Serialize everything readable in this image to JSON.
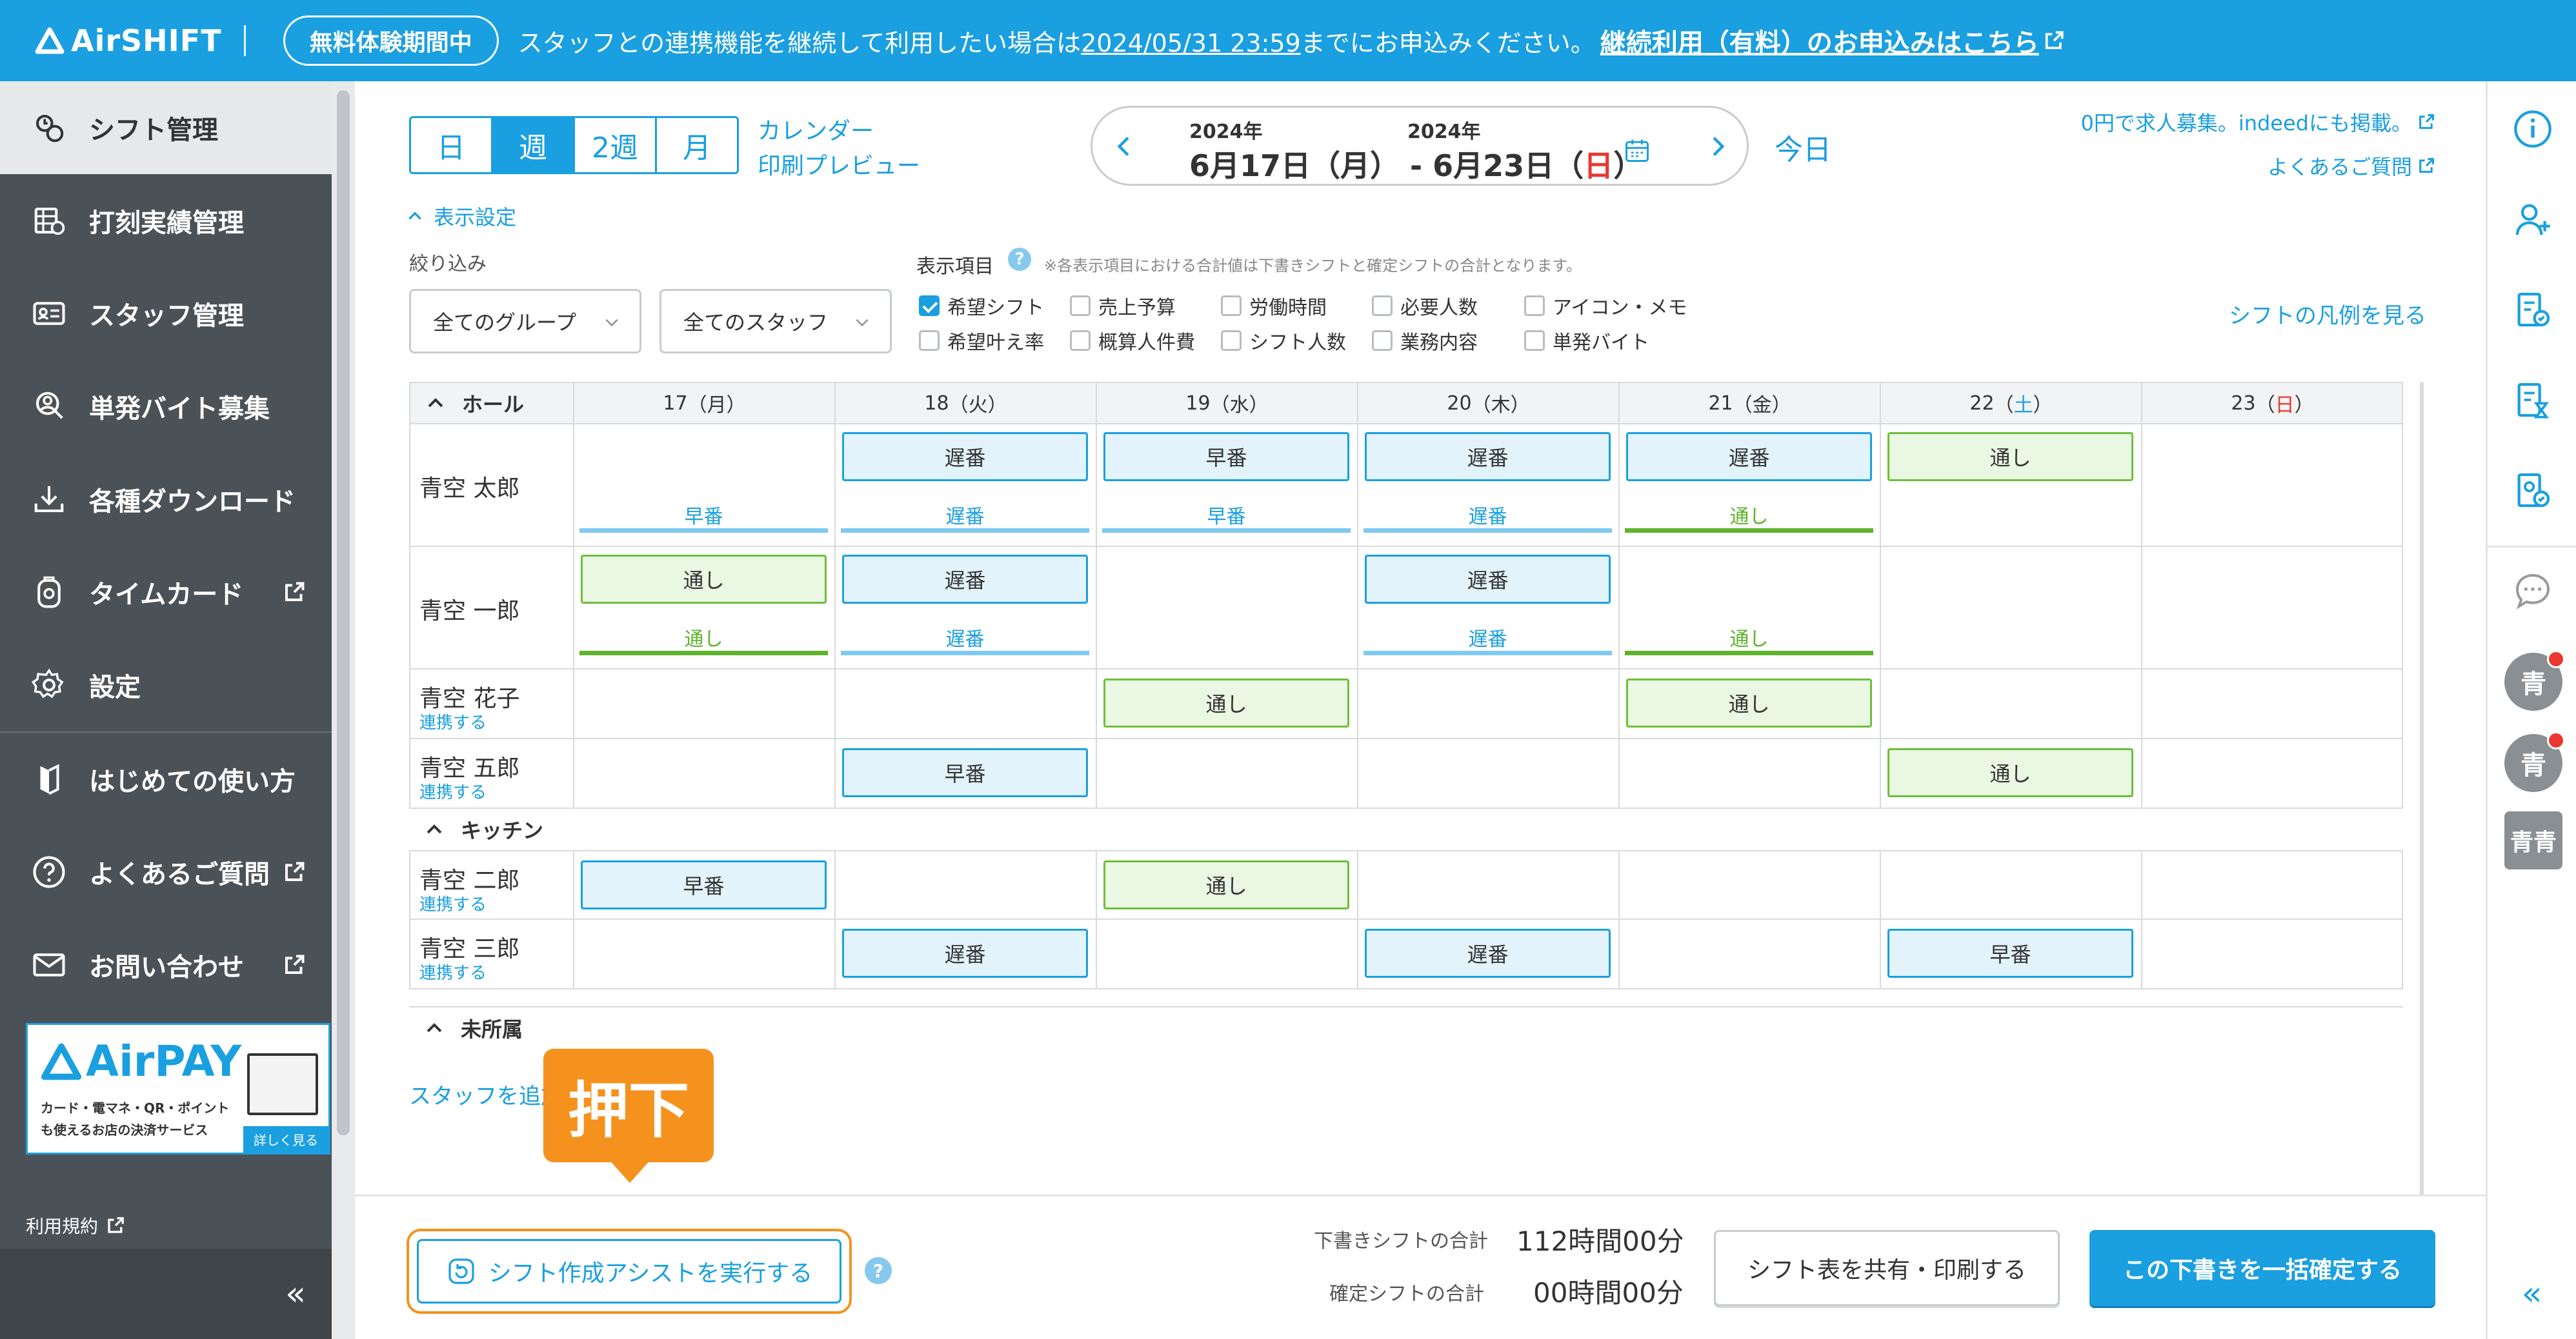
{
  "banner": {
    "logo": "AirSHIFT",
    "trial_badge": "無料体験期間中",
    "message_pre": "スタッフとの連携機能を継続して利用したい場合は",
    "message_date": "2024/05/31 23:59",
    "message_post": "までにお申込みください。",
    "cta": "継続利用（有料）のお申込みはこちら"
  },
  "sidebar": {
    "items": [
      {
        "label": "シフト管理",
        "icon": "shift-icon"
      },
      {
        "label": "打刻実績管理",
        "icon": "clock-record-icon"
      },
      {
        "label": "スタッフ管理",
        "icon": "staff-card-icon"
      },
      {
        "label": "単発バイト募集",
        "icon": "recruit-icon"
      },
      {
        "label": "各種ダウンロード",
        "icon": "download-icon"
      },
      {
        "label": "タイムカード",
        "icon": "timecard-icon"
      },
      {
        "label": "設定",
        "icon": "gear-icon"
      },
      {
        "label": "はじめての使い方",
        "icon": "guide-icon"
      },
      {
        "label": "よくあるご質問",
        "icon": "question-icon"
      },
      {
        "label": "お問い合わせ",
        "icon": "mail-icon"
      }
    ],
    "ad": {
      "logo": "AirPAY",
      "desc": "カード・電マネ・QR・ポイントも使えるお店の決済サービス",
      "more": "詳しく見る"
    },
    "terms": "利用規約",
    "collapse": "«"
  },
  "toolbar": {
    "views": [
      "日",
      "週",
      "2週",
      "月"
    ],
    "calendar_preview": "カレンダー",
    "print_preview": "印刷プレビュー",
    "year_start": "2024年",
    "year_end": "2024年",
    "range_start": "6月17日（月）",
    "range_sep": " - ",
    "range_end_pre": "6月23日（",
    "range_end_day": "日",
    "range_end_post": "）",
    "today": "今日",
    "indeed_link": "0円で求人募集。indeedにも掲載。",
    "faq_link": "よくあるご質問"
  },
  "settings": {
    "toggle": "表示設定",
    "filter_label": "絞り込み",
    "group_select": "全てのグループ",
    "staff_select": "全てのスタッフ",
    "items_label": "表示項目",
    "items_note": "※各表示項目における合計値は下書きシフトと確定シフトの合計となります。",
    "checkboxes": [
      {
        "label": "希望シフト",
        "checked": true
      },
      {
        "label": "売上予算",
        "checked": false
      },
      {
        "label": "労働時間",
        "checked": false
      },
      {
        "label": "必要人数",
        "checked": false
      },
      {
        "label": "アイコン・メモ",
        "checked": false
      },
      {
        "label": "希望叶え率",
        "checked": false
      },
      {
        "label": "概算人件費",
        "checked": false
      },
      {
        "label": "シフト人数",
        "checked": false
      },
      {
        "label": "業務内容",
        "checked": false
      },
      {
        "label": "単発バイト",
        "checked": false
      }
    ],
    "legend_link": "シフトの凡例を見る"
  },
  "grid": {
    "days": [
      {
        "num": "17",
        "wd": "月",
        "color": "#333333"
      },
      {
        "num": "18",
        "wd": "火",
        "color": "#333333"
      },
      {
        "num": "19",
        "wd": "水",
        "color": "#333333"
      },
      {
        "num": "20",
        "wd": "木",
        "color": "#333333"
      },
      {
        "num": "21",
        "wd": "金",
        "color": "#333333"
      },
      {
        "num": "22",
        "wd": "土",
        "color": "#1a9fe0"
      },
      {
        "num": "23",
        "wd": "日",
        "color": "#e8382f"
      }
    ],
    "groups": [
      "ホール",
      "キッチン",
      "未所属"
    ],
    "link_label": "連携する",
    "add_staff": "スタッフを追加",
    "staff": [
      {
        "name": "青空 太郎",
        "group": 0,
        "linked": true,
        "shifts": [
          null,
          [
            "遅番",
            "b"
          ],
          [
            "早番",
            "b"
          ],
          [
            "遅番",
            "b"
          ],
          [
            "遅番",
            "b"
          ],
          [
            "通し",
            "g"
          ],
          null
        ],
        "hopes": [
          [
            "早番",
            "b"
          ],
          [
            "遅番",
            "b"
          ],
          [
            "早番",
            "b"
          ],
          [
            "遅番",
            "b"
          ],
          [
            "通し",
            "g"
          ],
          null,
          null
        ]
      },
      {
        "name": "青空 一郎",
        "group": 0,
        "linked": true,
        "shifts": [
          [
            "通し",
            "g"
          ],
          [
            "遅番",
            "b"
          ],
          null,
          [
            "遅番",
            "b"
          ],
          null,
          null,
          null
        ],
        "hopes": [
          [
            "通し",
            "g"
          ],
          [
            "遅番",
            "b"
          ],
          null,
          [
            "遅番",
            "b"
          ],
          [
            "通し",
            "g"
          ],
          null,
          null
        ]
      },
      {
        "name": "青空 花子",
        "group": 0,
        "linked": false,
        "shifts": [
          null,
          null,
          [
            "通し",
            "g"
          ],
          null,
          [
            "通し",
            "g"
          ],
          null,
          null
        ],
        "hopes": []
      },
      {
        "name": "青空 五郎",
        "group": 0,
        "linked": false,
        "shifts": [
          null,
          [
            "早番",
            "b"
          ],
          null,
          null,
          null,
          [
            "通し",
            "g"
          ],
          null
        ],
        "hopes": []
      },
      {
        "name": "青空 二郎",
        "group": 1,
        "linked": false,
        "shifts": [
          [
            "早番",
            "b"
          ],
          null,
          [
            "通し",
            "g"
          ],
          null,
          null,
          null,
          null
        ],
        "hopes": []
      },
      {
        "name": "青空 三郎",
        "group": 1,
        "linked": false,
        "shifts": [
          null,
          [
            "遅番",
            "b"
          ],
          null,
          [
            "遅番",
            "b"
          ],
          null,
          [
            "早番",
            "b"
          ],
          null
        ],
        "hopes": []
      }
    ]
  },
  "footer": {
    "assist": "シフト作成アシストを実行する",
    "draft_label": "下書きシフトの合計",
    "draft_value": "112時間00分",
    "fixed_label": "確定シフトの合計",
    "fixed_value": "00時間00分",
    "share": "シフト表を共有・印刷する",
    "confirm": "この下書きを一括確定する"
  },
  "right_rail": {
    "avatars": [
      "青",
      "青",
      "青青"
    ],
    "collapse": "«"
  },
  "callout": "押下",
  "colors": {
    "brand": "#1a9fe0",
    "accent_orange": "#f5921e",
    "hope_green": "#5fb32e",
    "sidebar_bg": "#4b5257"
  }
}
